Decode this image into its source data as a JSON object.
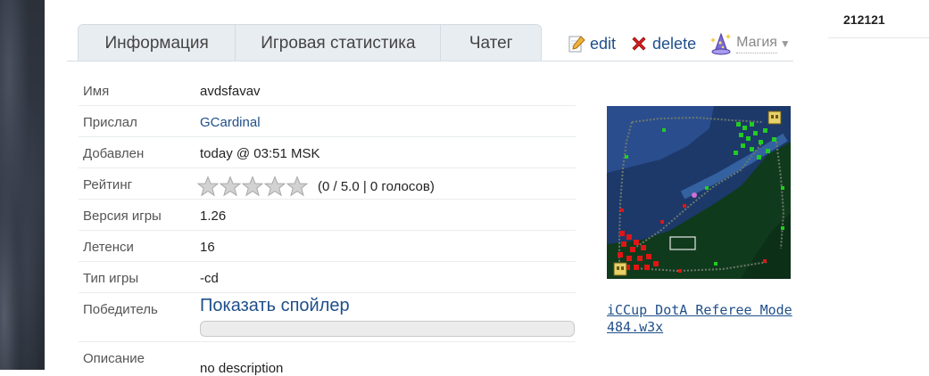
{
  "header": {
    "user_text": "212121"
  },
  "tabs": [
    {
      "label": "Информация"
    },
    {
      "label": "Игровая статистика"
    },
    {
      "label": "Чатег"
    }
  ],
  "actions": {
    "edit_label": "edit",
    "delete_label": "delete",
    "magic_label": "Магия"
  },
  "info": {
    "name": {
      "label": "Имя",
      "value": "avdsfavav"
    },
    "sender": {
      "label": "Прислал",
      "value": "GCardinal"
    },
    "added": {
      "label": "Добавлен",
      "value": "today @ 03:51 MSK"
    },
    "rating": {
      "label": "Рейтинг",
      "value": "(0 / 5.0 | 0 голосов)",
      "stars_filled": 0,
      "stars_total": 5
    },
    "version": {
      "label": "Версия игры",
      "value": "1.26"
    },
    "latency": {
      "label": "Летенси",
      "value": "16"
    },
    "game_type": {
      "label": "Тип игры",
      "value": "-cd"
    },
    "winner": {
      "label": "Победитель",
      "spoiler_label": "Показать спойлер"
    },
    "description": {
      "label": "Описание",
      "value": "no description"
    }
  },
  "map": {
    "link": "iCCup DotA Referee Mode 484.w3x"
  },
  "colors": {
    "link": "#1f4f8a",
    "tab_bg": "#e8edf2",
    "minimap_water": "#1f3c7c",
    "minimap_forest": "#0f3a1a",
    "sentinel": "#22cc22",
    "scourge": "#e01515"
  },
  "icons": {
    "edit": "pencil-page-icon",
    "delete": "red-x-icon",
    "magic": "wizard-hat-icon",
    "star": "star-icon"
  }
}
